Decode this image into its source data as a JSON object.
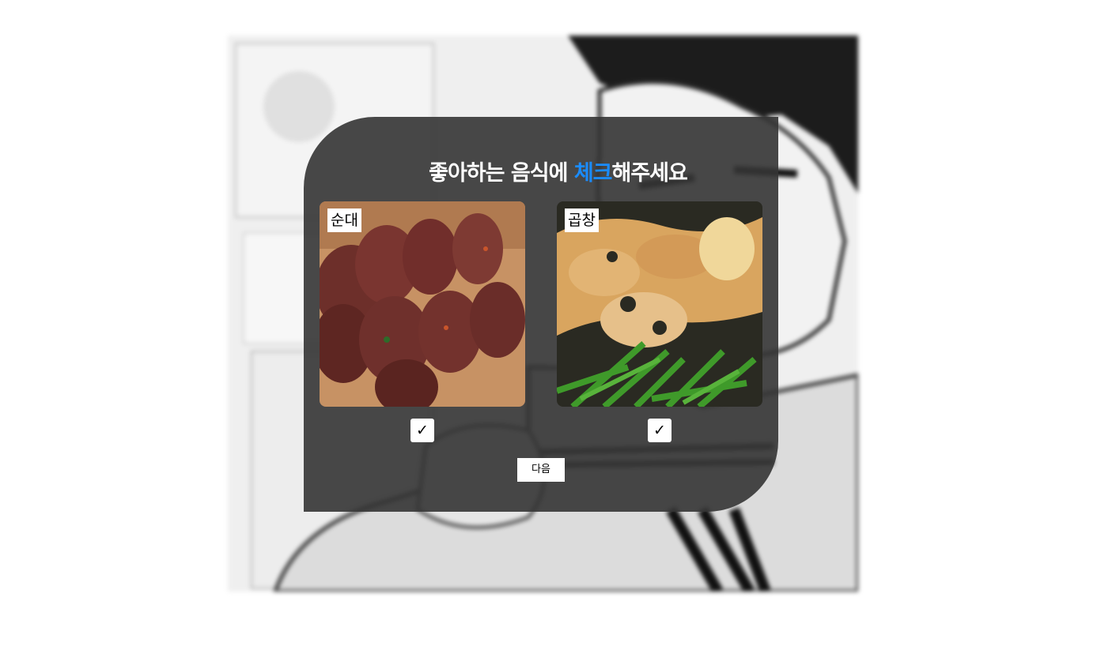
{
  "title": {
    "before": "좋아하는 음식에 ",
    "accent": "체크",
    "after": "해주세요",
    "accent_color": "#1a8cff"
  },
  "foods": [
    {
      "label": "순대",
      "checked": true,
      "check_mark": "✓"
    },
    {
      "label": "곱창",
      "checked": true,
      "check_mark": "✓"
    }
  ],
  "next_button": {
    "label": "다음"
  },
  "colors": {
    "panel": "#343434",
    "text": "#ffffff"
  }
}
